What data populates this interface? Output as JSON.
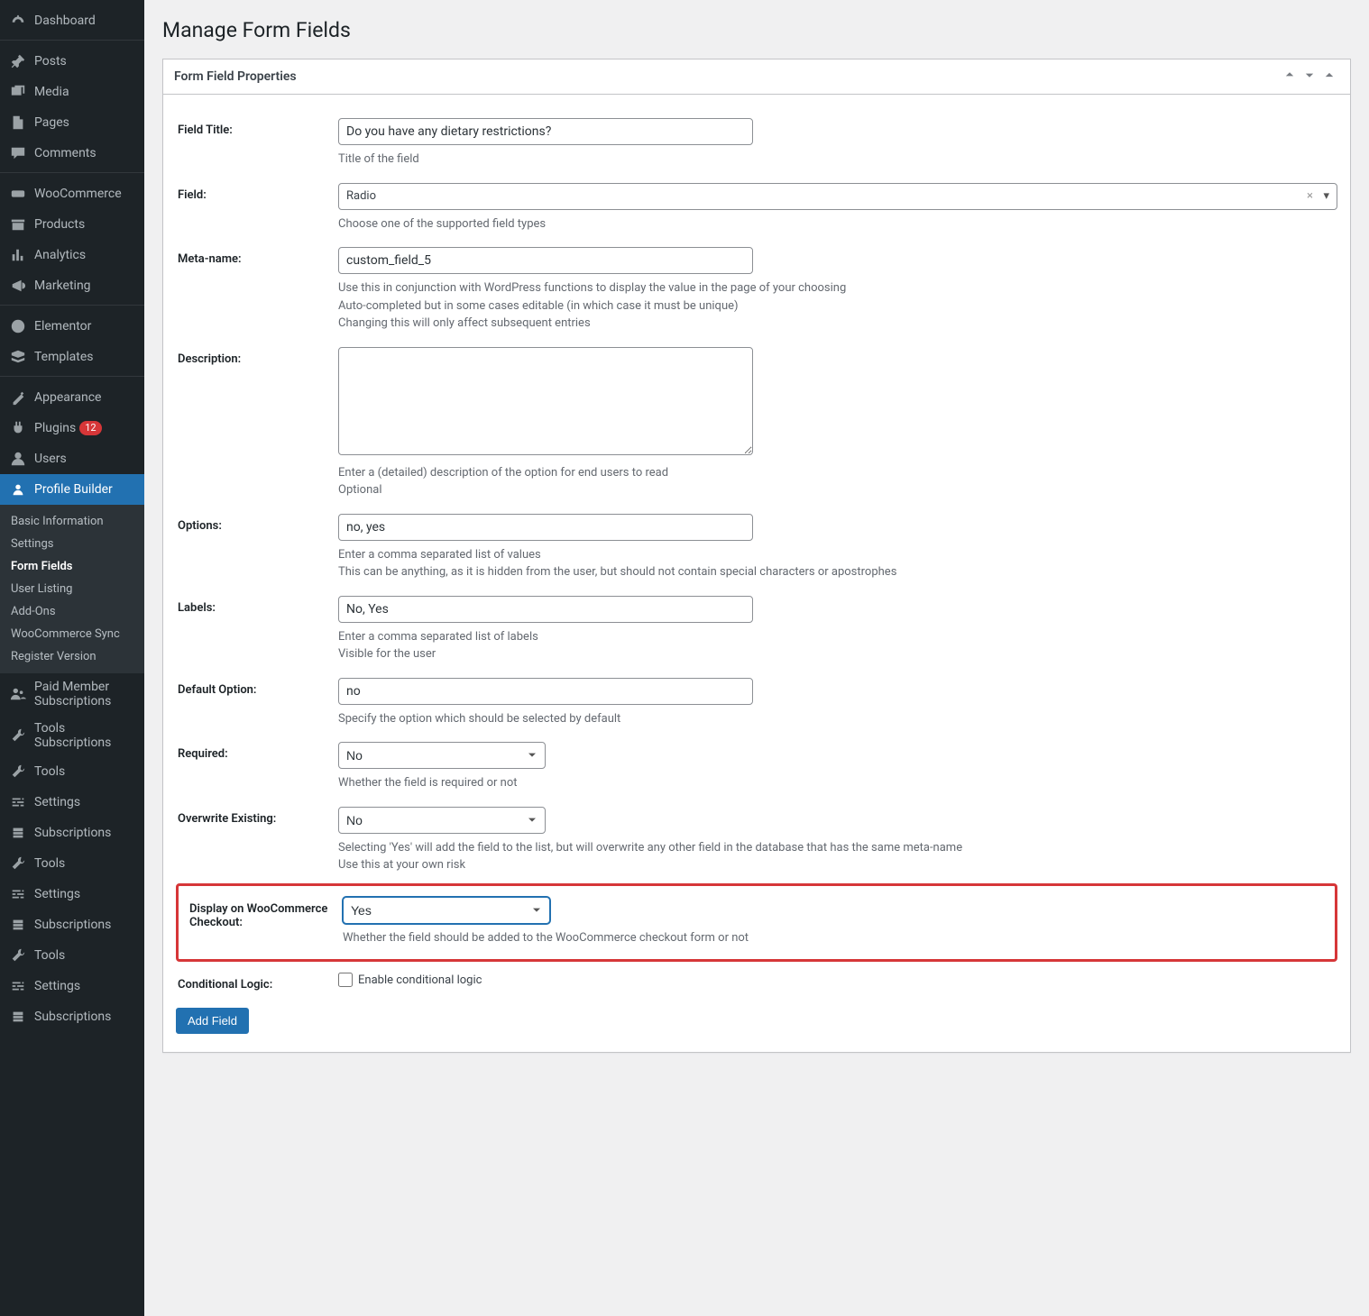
{
  "page": {
    "title": "Manage Form Fields"
  },
  "sidebar": {
    "groups": [
      [
        {
          "icon": "dashboard",
          "label": "Dashboard"
        }
      ],
      [
        {
          "icon": "pin",
          "label": "Posts"
        },
        {
          "icon": "media",
          "label": "Media"
        },
        {
          "icon": "page",
          "label": "Pages"
        },
        {
          "icon": "comment",
          "label": "Comments"
        }
      ],
      [
        {
          "icon": "woo",
          "label": "WooCommerce"
        },
        {
          "icon": "products",
          "label": "Products"
        },
        {
          "icon": "analytics",
          "label": "Analytics"
        },
        {
          "icon": "marketing",
          "label": "Marketing"
        }
      ],
      [
        {
          "icon": "elementor",
          "label": "Elementor"
        },
        {
          "icon": "templates",
          "label": "Templates"
        }
      ],
      [
        {
          "icon": "appearance",
          "label": "Appearance"
        },
        {
          "icon": "plugins",
          "label": "Plugins",
          "badge": "12"
        },
        {
          "icon": "users",
          "label": "Users"
        },
        {
          "icon": "profile",
          "label": "Profile Builder",
          "active": true
        }
      ]
    ],
    "submenu": [
      {
        "label": "Basic Information"
      },
      {
        "label": "Settings"
      },
      {
        "label": "Form Fields",
        "active": true
      },
      {
        "label": "User Listing"
      },
      {
        "label": "Add-Ons"
      },
      {
        "label": "WooCommerce Sync"
      },
      {
        "label": "Register Version"
      }
    ],
    "tail": [
      {
        "icon": "paid",
        "label": "Paid Member Subscriptions"
      },
      {
        "icon": "tools",
        "label": "Tools Subscriptions"
      },
      {
        "icon": "tools",
        "label": "Tools"
      },
      {
        "icon": "settings",
        "label": "Settings"
      },
      {
        "icon": "sub",
        "label": "Subscriptions"
      },
      {
        "icon": "tools",
        "label": "Tools"
      },
      {
        "icon": "settings",
        "label": "Settings"
      },
      {
        "icon": "sub",
        "label": "Subscriptions"
      },
      {
        "icon": "tools",
        "label": "Tools"
      },
      {
        "icon": "settings",
        "label": "Settings"
      },
      {
        "icon": "sub",
        "label": "Subscriptions"
      }
    ]
  },
  "panel": {
    "title": "Form Field Properties"
  },
  "fields": {
    "field_title": {
      "label": "Field Title:",
      "value": "Do you have any dietary restrictions?",
      "help": "Title of the field"
    },
    "field_type": {
      "label": "Field:",
      "value": "Radio",
      "help": "Choose one of the supported field types"
    },
    "meta_name": {
      "label": "Meta-name:",
      "value": "custom_field_5",
      "help1": "Use this in conjunction with WordPress functions to display the value in the page of your choosing",
      "help2": "Auto-completed but in some cases editable (in which case it must be unique)",
      "help3": "Changing this will only affect subsequent entries"
    },
    "description": {
      "label": "Description:",
      "value": "",
      "help1": "Enter a (detailed) description of the option for end users to read",
      "help2": "Optional"
    },
    "options": {
      "label": "Options:",
      "value": "no, yes",
      "help1": "Enter a comma separated list of values",
      "help2": "This can be anything, as it is hidden from the user, but should not contain special characters or apostrophes"
    },
    "labels": {
      "label": "Labels:",
      "value": "No, Yes",
      "help1": "Enter a comma separated list of labels",
      "help2": "Visible for the user"
    },
    "default_option": {
      "label": "Default Option:",
      "value": "no",
      "help": "Specify the option which should be selected by default"
    },
    "required": {
      "label": "Required:",
      "value": "No",
      "help": "Whether the field is required or not"
    },
    "overwrite": {
      "label": "Overwrite Existing:",
      "value": "No",
      "help1": "Selecting 'Yes' will add the field to the list, but will overwrite any other field in the database that has the same meta-name",
      "help2": "Use this at your own risk"
    },
    "woo_checkout": {
      "label": "Display on WooCommerce Checkout:",
      "value": "Yes",
      "help": "Whether the field should be added to the WooCommerce checkout form or not"
    },
    "conditional": {
      "label": "Conditional Logic:",
      "checkbox_label": "Enable conditional logic"
    }
  },
  "buttons": {
    "add_field": "Add Field"
  }
}
